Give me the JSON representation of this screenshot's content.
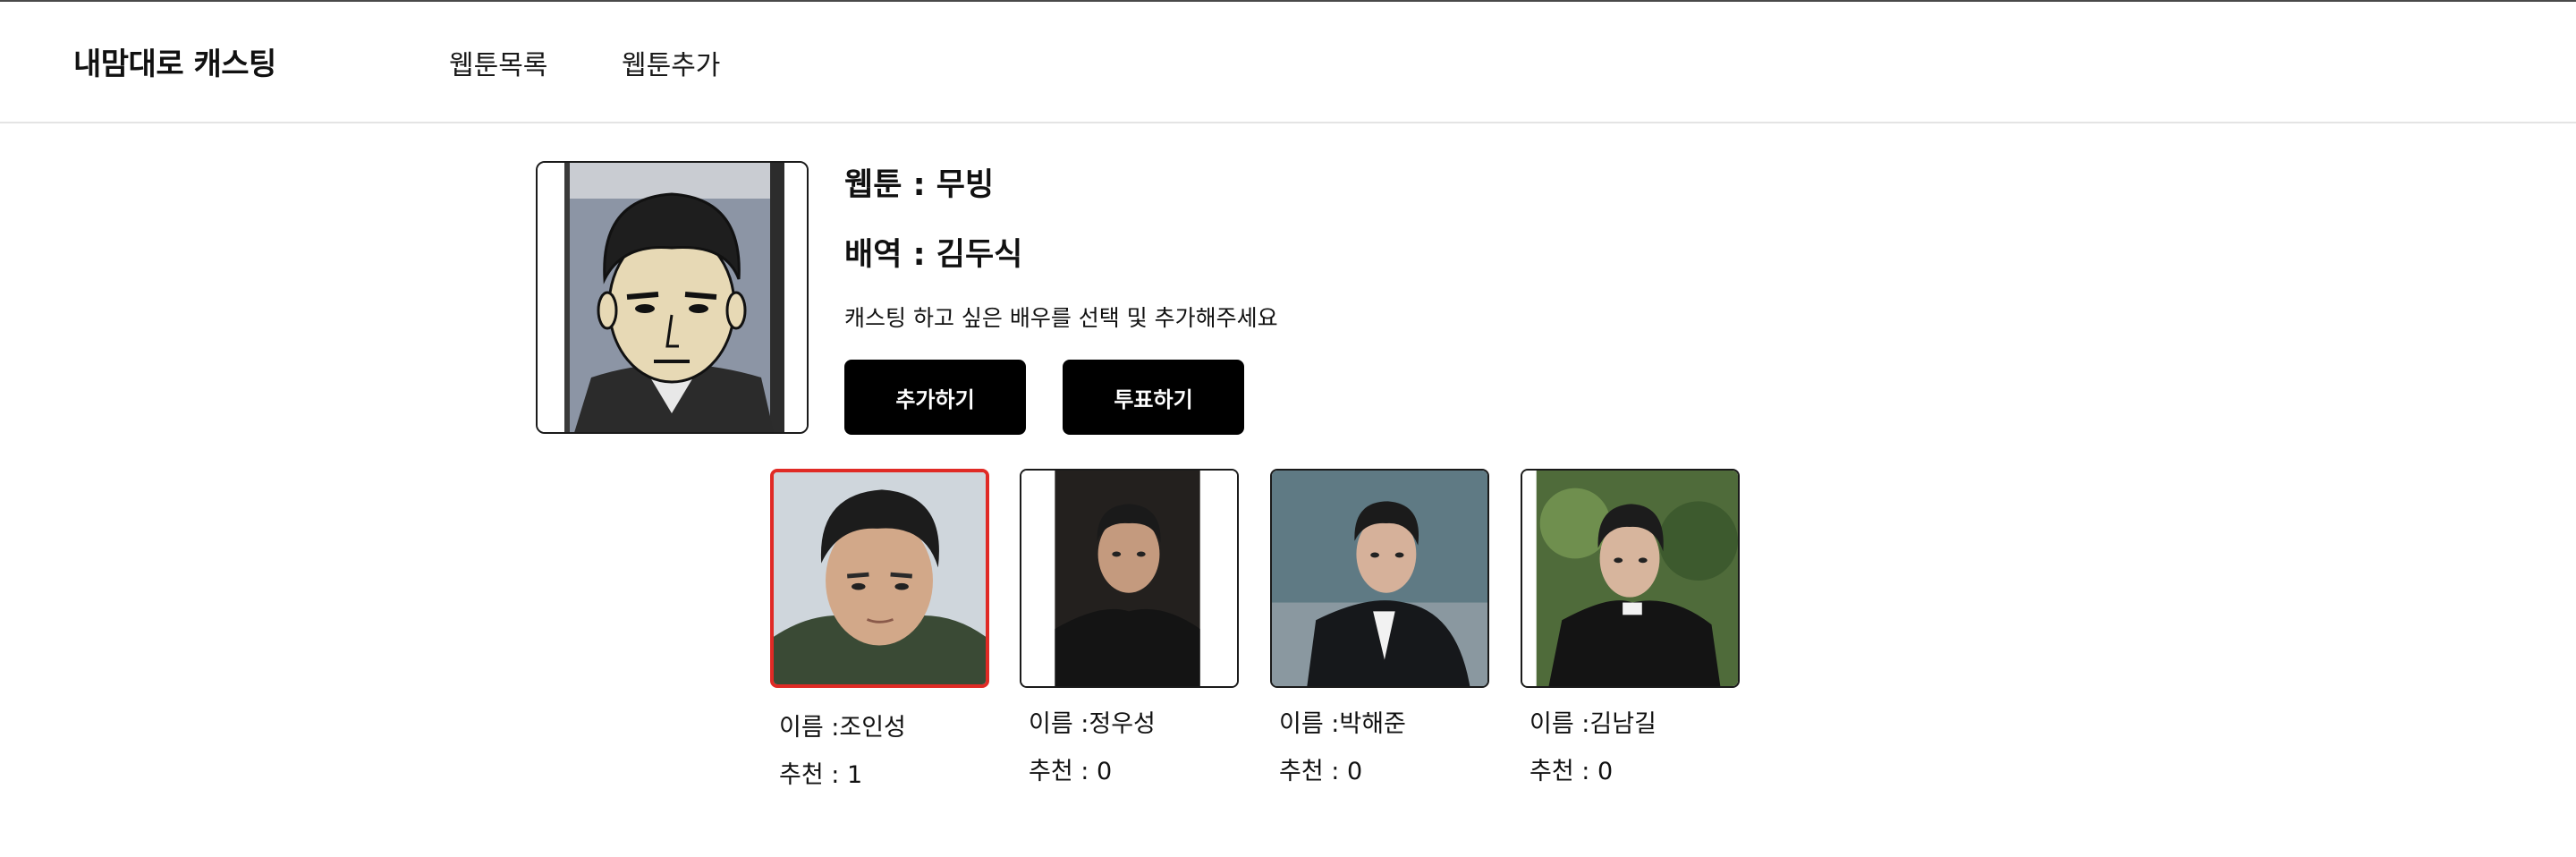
{
  "header": {
    "brand": "내맘대로 캐스팅",
    "nav": [
      {
        "label": "웹툰목록"
      },
      {
        "label": "웹툰추가"
      }
    ]
  },
  "detail": {
    "webtoon_line": "웹툰 : 무빙",
    "role_line": "배역 : 김두식",
    "instruction": "캐스팅 하고 싶은 배우를 선택 및 추가해주세요",
    "add_button": "추가하기",
    "vote_button": "투표하기"
  },
  "actors": [
    {
      "name_line": "이름 :조인성",
      "votes_line": "추천 : 1",
      "selected": true
    },
    {
      "name_line": "이름 :정우성",
      "votes_line": "추천 : 0",
      "selected": false
    },
    {
      "name_line": "이름 :박해준",
      "votes_line": "추천 : 0",
      "selected": false
    },
    {
      "name_line": "이름 :김남길",
      "votes_line": "추천 : 0",
      "selected": false
    }
  ],
  "colors": {
    "accent_button": "#000000",
    "selected_border": "#e02a25"
  }
}
